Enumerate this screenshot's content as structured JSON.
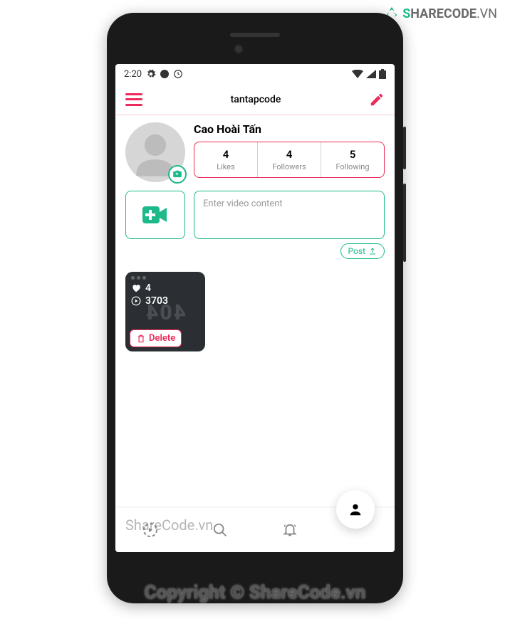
{
  "status": {
    "time": "2:20"
  },
  "header": {
    "title": "tantapcode"
  },
  "profile": {
    "name": "Cao Hoài Tấn",
    "stats": {
      "likes": {
        "value": "4",
        "label": "Likes"
      },
      "followers": {
        "value": "4",
        "label": "Followers"
      },
      "following": {
        "value": "5",
        "label": "Following"
      }
    }
  },
  "compose": {
    "placeholder": "Enter video content",
    "post_label": "Post"
  },
  "video": {
    "likes": "4",
    "views": "3703",
    "bg_text": "404",
    "delete_label": "Delete"
  },
  "watermark": {
    "logo_s": "S",
    "logo_rest": "HARECODE",
    "logo_vn": ".VN",
    "mid": "ShareCode.vn",
    "bottom": "Copyright © ShareCode.vn"
  }
}
